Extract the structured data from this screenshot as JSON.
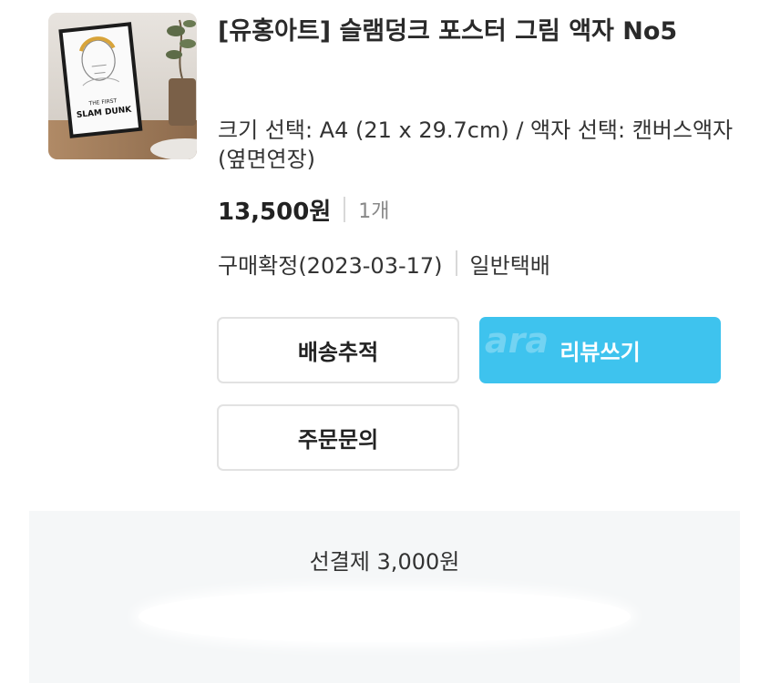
{
  "product": {
    "title": "[유홍아트] 슬램덩크 포스터 그림 액자 No5",
    "thumbnail_icon": "product-photo-framed-poster",
    "poster_text": "SLAM DUNK",
    "poster_subtitle": "THE FIRST",
    "option": "크기 선택: A4 (21 x 29.7cm) / 액자 선택: 캔버스액자(옆면연장)",
    "price": "13,500원",
    "quantity": "1개",
    "purchase_status": "구매확정(2023-03-17)",
    "delivery_type": "일반택배"
  },
  "buttons": {
    "track": "배송추적",
    "review": "리뷰쓰기",
    "inquiry": "주문문의",
    "review_watermark": "ara"
  },
  "shipping": {
    "prepaid_text": "선결제 3,000원"
  },
  "colors": {
    "review_button": "#3ec3ee",
    "panel_background": "#f5f7f8",
    "button_border": "#e2e2e2"
  }
}
